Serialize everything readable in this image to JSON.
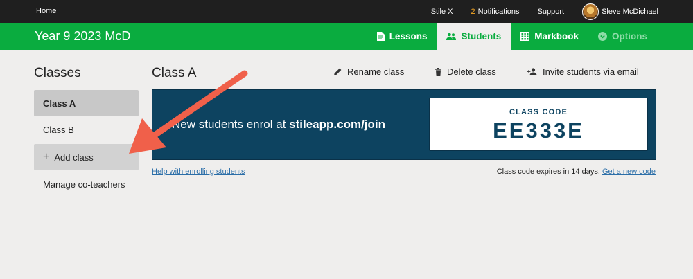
{
  "topbar": {
    "home": "Home",
    "stile_x": "Stile X",
    "notifications_count": "2",
    "notifications_label": "Notifications",
    "support": "Support",
    "user_name": "Sleve McDichael"
  },
  "header": {
    "course_title": "Year 9 2023 McD",
    "tabs": [
      {
        "label": "Lessons",
        "icon": "document-icon"
      },
      {
        "label": "Students",
        "icon": "people-icon"
      },
      {
        "label": "Markbook",
        "icon": "grid-icon"
      },
      {
        "label": "Options",
        "icon": "chevron-circle-icon"
      }
    ]
  },
  "sidebar": {
    "title": "Classes",
    "items": [
      {
        "label": "Class A"
      },
      {
        "label": "Class B"
      },
      {
        "label": "Add class"
      },
      {
        "label": "Manage co-teachers"
      }
    ]
  },
  "main": {
    "class_title": "Class A",
    "actions": {
      "rename": "Rename class",
      "delete": "Delete class",
      "invite": "Invite students via email"
    },
    "banner": {
      "enrol_prefix": "New students enrol at ",
      "enrol_url": "stileapp.com/join",
      "code_label": "CLASS CODE",
      "code_value": "EE333E"
    },
    "help_link": "Help with enrolling students",
    "expiry_text": "Class code expires in 14 days.",
    "new_code_link": "Get a new code"
  },
  "colors": {
    "topbar": "#1f1f1f",
    "brand_green": "#0aac3f",
    "banner": "#0d4360",
    "annotation_arrow": "#f0604a",
    "link": "#2b6ea8"
  }
}
